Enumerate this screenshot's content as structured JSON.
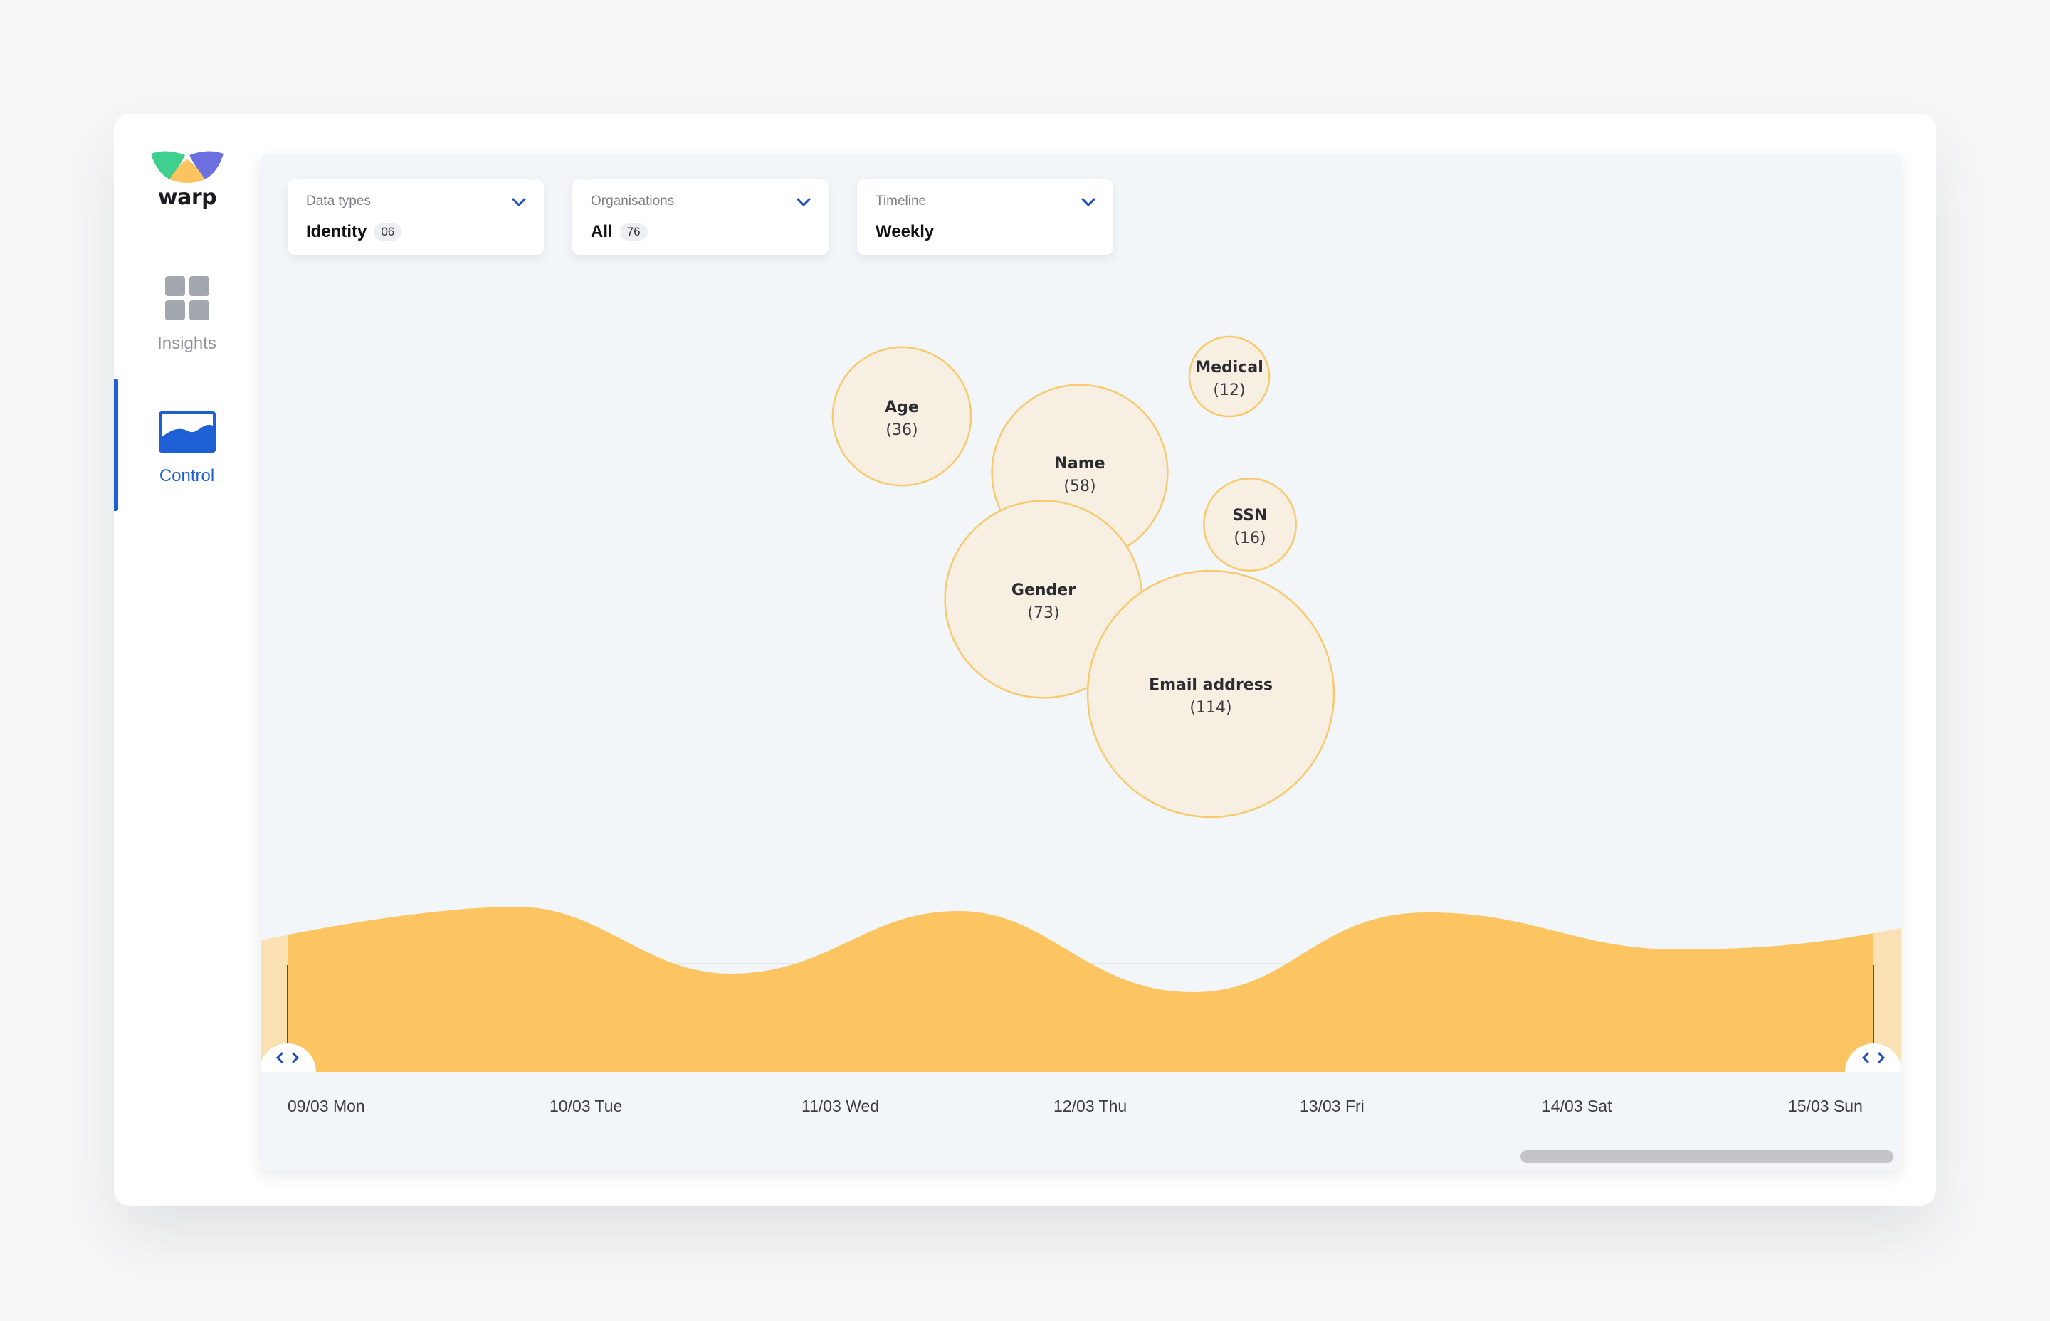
{
  "brand": {
    "name": "warp",
    "colors": {
      "green": "#3fcf8e",
      "yellow": "#fcc35f",
      "purple": "#6b6fe0"
    }
  },
  "sidebar": {
    "items": [
      {
        "label": "Insights",
        "icon": "grid-icon",
        "active": false
      },
      {
        "label": "Control",
        "icon": "area-chart-icon",
        "active": true
      }
    ]
  },
  "filters": [
    {
      "label": "Data types",
      "value": "Identity",
      "count": "06"
    },
    {
      "label": "Organisations",
      "value": "All",
      "count": "76"
    },
    {
      "label": "Timeline",
      "value": "Weekly",
      "count": ""
    }
  ],
  "bubbles": [
    {
      "name": "Age",
      "count": "(36)",
      "value": 36
    },
    {
      "name": "Name",
      "count": "(58)",
      "value": 58
    },
    {
      "name": "Medical",
      "count": "(12)",
      "value": 12
    },
    {
      "name": "SSN",
      "count": "(16)",
      "value": 16
    },
    {
      "name": "Gender",
      "count": "(73)",
      "value": 73
    },
    {
      "name": "Email address",
      "count": "(114)",
      "value": 114
    }
  ],
  "timeline": {
    "days": [
      "09/03 Mon",
      "10/03 Tue",
      "11/03 Wed",
      "12/03 Thu",
      "13/03 Fri",
      "14/03 Sat",
      "15/03 Sun"
    ],
    "range_start": "09/03 Mon",
    "range_end": "15/03 Sun",
    "fill_color": "#fdc561",
    "out_of_range_color": "#f9e1b4"
  }
}
